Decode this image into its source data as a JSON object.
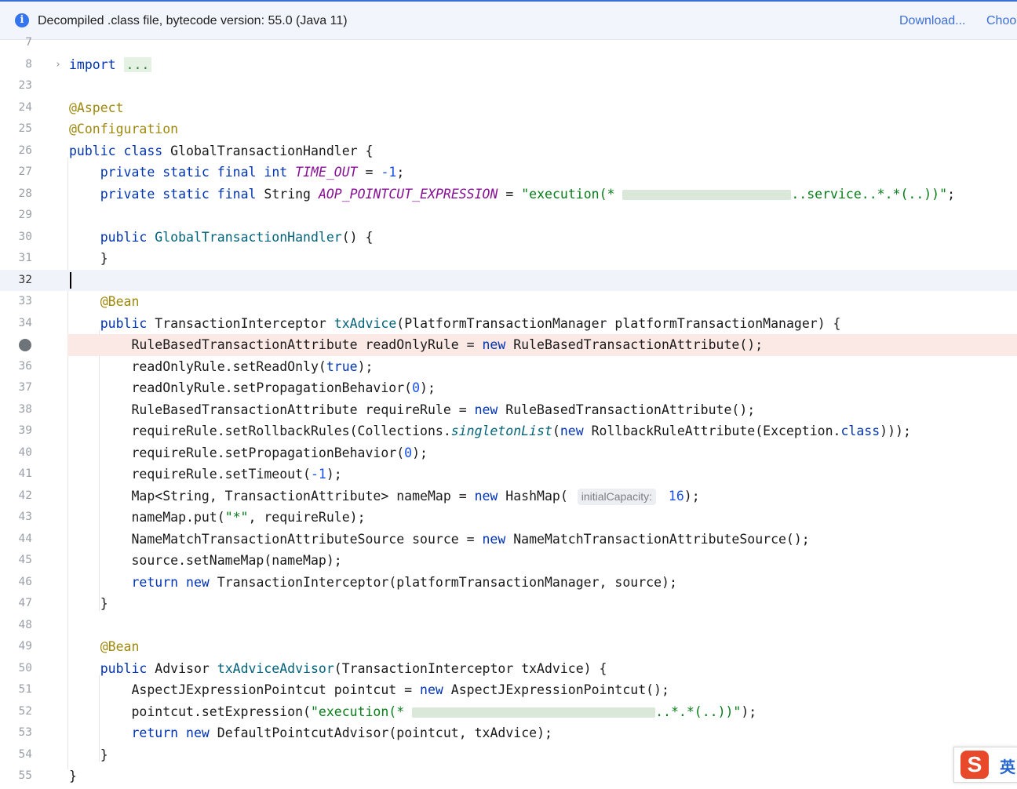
{
  "banner": {
    "message": "Decompiled .class file, bytecode version: 55.0 (Java 11)",
    "download_label": "Download...",
    "choose_label": "Choo",
    "info_glyph": "i"
  },
  "editor": {
    "current_line": "32",
    "breakpoint_line": "35",
    "lines": [
      {
        "n": "7",
        "code": ""
      },
      {
        "n": "8",
        "code": "import ..."
      },
      {
        "n": "23",
        "code": ""
      },
      {
        "n": "24",
        "code": "@Aspect"
      },
      {
        "n": "25",
        "code": "@Configuration"
      },
      {
        "n": "26",
        "code": "public class GlobalTransactionHandler {"
      },
      {
        "n": "27",
        "code": "    private static final int TIME_OUT = -1;"
      },
      {
        "n": "28",
        "code": "    private static final String AOP_POINTCUT_EXPRESSION = \"execution(* [redacted]..service..*.*(..))\";"
      },
      {
        "n": "29",
        "code": ""
      },
      {
        "n": "30",
        "code": "    public GlobalTransactionHandler() {"
      },
      {
        "n": "31",
        "code": "    }"
      },
      {
        "n": "32",
        "code": ""
      },
      {
        "n": "33",
        "code": "    @Bean"
      },
      {
        "n": "34",
        "code": "    public TransactionInterceptor txAdvice(PlatformTransactionManager platformTransactionManager) {"
      },
      {
        "n": "35",
        "code": "        RuleBasedTransactionAttribute readOnlyRule = new RuleBasedTransactionAttribute();"
      },
      {
        "n": "36",
        "code": "        readOnlyRule.setReadOnly(true);"
      },
      {
        "n": "37",
        "code": "        readOnlyRule.setPropagationBehavior(0);"
      },
      {
        "n": "38",
        "code": "        RuleBasedTransactionAttribute requireRule = new RuleBasedTransactionAttribute();"
      },
      {
        "n": "39",
        "code": "        requireRule.setRollbackRules(Collections.singletonList(new RollbackRuleAttribute(Exception.class)));"
      },
      {
        "n": "40",
        "code": "        requireRule.setPropagationBehavior(0);"
      },
      {
        "n": "41",
        "code": "        requireRule.setTimeout(-1);"
      },
      {
        "n": "42",
        "code": "        Map<String, TransactionAttribute> nameMap = new HashMap( initialCapacity: 16);"
      },
      {
        "n": "43",
        "code": "        nameMap.put(\"*\", requireRule);"
      },
      {
        "n": "44",
        "code": "        NameMatchTransactionAttributeSource source = new NameMatchTransactionAttributeSource();"
      },
      {
        "n": "45",
        "code": "        source.setNameMap(nameMap);"
      },
      {
        "n": "46",
        "code": "        return new TransactionInterceptor(platformTransactionManager, source);"
      },
      {
        "n": "47",
        "code": "    }"
      },
      {
        "n": "48",
        "code": ""
      },
      {
        "n": "49",
        "code": "    @Bean"
      },
      {
        "n": "50",
        "code": "    public Advisor txAdviceAdvisor(TransactionInterceptor txAdvice) {"
      },
      {
        "n": "51",
        "code": "        AspectJExpressionPointcut pointcut = new AspectJExpressionPointcut();"
      },
      {
        "n": "52",
        "code": "        pointcut.setExpression(\"execution(* [redacted]..*.*(..))\");"
      },
      {
        "n": "53",
        "code": "        return new DefaultPointcutAdvisor(pointcut, txAdvice);"
      },
      {
        "n": "54",
        "code": "    }"
      },
      {
        "n": "55",
        "code": "}"
      }
    ],
    "inlay_hint": "initialCapacity:"
  },
  "ime": {
    "logo": "S",
    "language": "英"
  },
  "colors": {
    "keyword": "#0033b3",
    "annotation": "#9e880d",
    "string": "#067d17",
    "number": "#1750eb",
    "constant": "#871094",
    "method": "#00627a",
    "link": "#3d6fd8",
    "breakpoint_bg": "#fbe9e6",
    "current_line_bg": "#f0f3f9"
  }
}
